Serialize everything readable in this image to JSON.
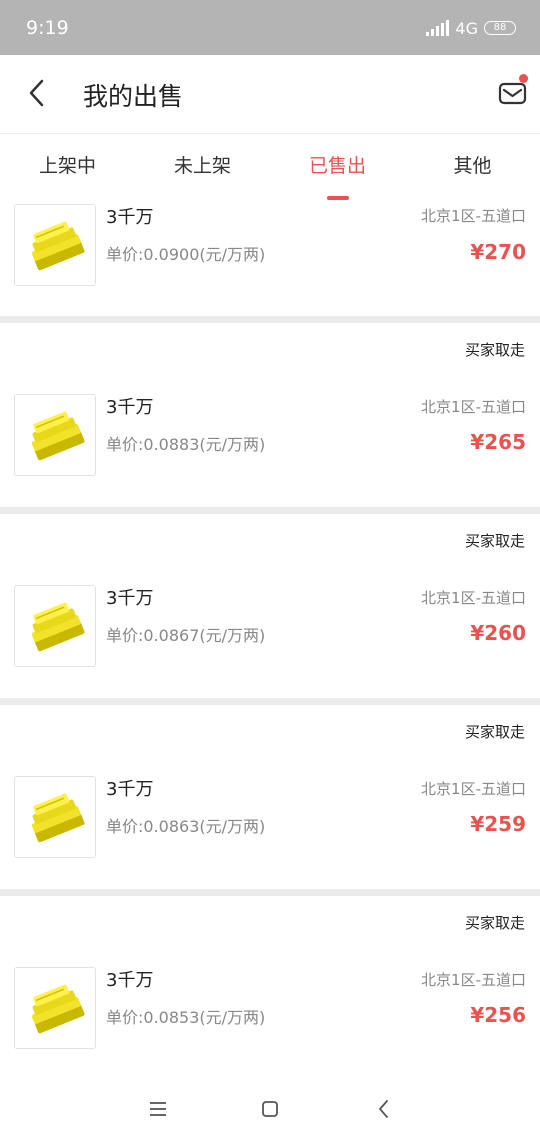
{
  "status_bar": {
    "time": "9:19",
    "network": "4G",
    "battery": "88"
  },
  "header": {
    "title": "我的出售"
  },
  "tabs": [
    {
      "label": "上架中",
      "active": false
    },
    {
      "label": "未上架",
      "active": false
    },
    {
      "label": "已售出",
      "active": true
    },
    {
      "label": "其他",
      "active": false
    }
  ],
  "orders": [
    {
      "status": "",
      "amount": "3千万",
      "unit_price": "单价:0.0900(元/万两)",
      "server": "北京1区-五道口",
      "total": "¥270"
    },
    {
      "status": "买家取走",
      "amount": "3千万",
      "unit_price": "单价:0.0883(元/万两)",
      "server": "北京1区-五道口",
      "total": "¥265"
    },
    {
      "status": "买家取走",
      "amount": "3千万",
      "unit_price": "单价:0.0867(元/万两)",
      "server": "北京1区-五道口",
      "total": "¥260"
    },
    {
      "status": "买家取走",
      "amount": "3千万",
      "unit_price": "单价:0.0863(元/万两)",
      "server": "北京1区-五道口",
      "total": "¥259"
    },
    {
      "status": "买家取走",
      "amount": "3千万",
      "unit_price": "单价:0.0853(元/万两)",
      "server": "北京1区-五道口",
      "total": "¥256"
    }
  ],
  "colors": {
    "accent": "#e8534f",
    "status_bar": "#b4b4b4",
    "separator": "#ebebeb"
  },
  "icons": {
    "back": "chevron-left-icon",
    "mail": "mail-icon",
    "item": "gold-bars-icon",
    "nav": [
      "menu-icon",
      "home-square-icon",
      "back-triangle-icon"
    ]
  }
}
